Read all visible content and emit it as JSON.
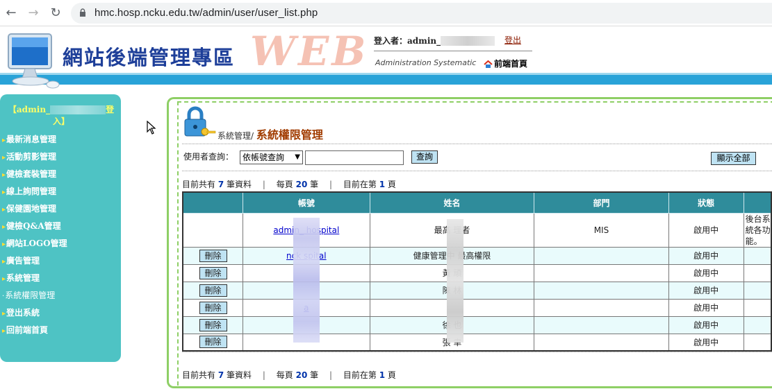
{
  "browser": {
    "url": "hmc.hosp.ncku.edu.tw/admin/user/user_list.php"
  },
  "header": {
    "site_title": "網站後端管理專區",
    "web_text": "WEB",
    "login_label": "登入者：admin_",
    "logout": "登出",
    "admin_sys": "Administration Systematic",
    "front_home": "前端首頁"
  },
  "sidebar": {
    "user_prefix": "【admin_",
    "user_suffix": "登",
    "user_line2": "入】",
    "items": [
      {
        "label": "最新消息管理"
      },
      {
        "label": "活動剪影管理"
      },
      {
        "label": "健檢套裝管理"
      },
      {
        "label": "線上詢問管理"
      },
      {
        "label": "保健園地管理"
      },
      {
        "label": "健檢Q&A管理"
      },
      {
        "label": "網站LOGO管理"
      },
      {
        "label": "廣告管理"
      },
      {
        "label": "系統管理"
      },
      {
        "label": "系統權限管理"
      },
      {
        "label": "登出系統"
      },
      {
        "label": "回前端首頁"
      }
    ]
  },
  "main": {
    "crumb_parent": "系統管理/",
    "crumb_title": "系統權限管理",
    "search_label": "使用者查詢：",
    "search_select": "依帳號查詢",
    "search_button": "查詢",
    "show_all_button": "顯示全部",
    "info": {
      "total_prefix": "目前共有",
      "total": "7",
      "total_suffix": "筆資料",
      "per_page_prefix": "每頁",
      "per_page": "20",
      "per_page_suffix": "筆",
      "page_prefix": "目前在第",
      "page": "1",
      "page_suffix": "頁"
    },
    "table": {
      "headers": [
        "帳號",
        "姓名",
        "部門",
        "狀態"
      ],
      "delete_label": "刪除",
      "rows": [
        {
          "account": "admin_          hospital",
          "name": "最高         理者",
          "dept": "MIS",
          "status": "啟用中",
          "note": "後台系統各功能。"
        },
        {
          "account": "nck       spital",
          "name": "健康管理中     最高權限",
          "dept": "",
          "status": "啟用中"
        },
        {
          "account": "",
          "name": "黃     頑",
          "dept": "",
          "status": "啟用中"
        },
        {
          "account": "",
          "name": "陳     林",
          "dept": "",
          "status": "啟用中"
        },
        {
          "account": "              a",
          "name": "",
          "dept": "",
          "status": "啟用中"
        },
        {
          "account": "",
          "name": "徐     也",
          "dept": "",
          "status": "啟用中"
        },
        {
          "account": "",
          "name": "張     聿",
          "dept": "",
          "status": "啟用中"
        }
      ]
    }
  }
}
